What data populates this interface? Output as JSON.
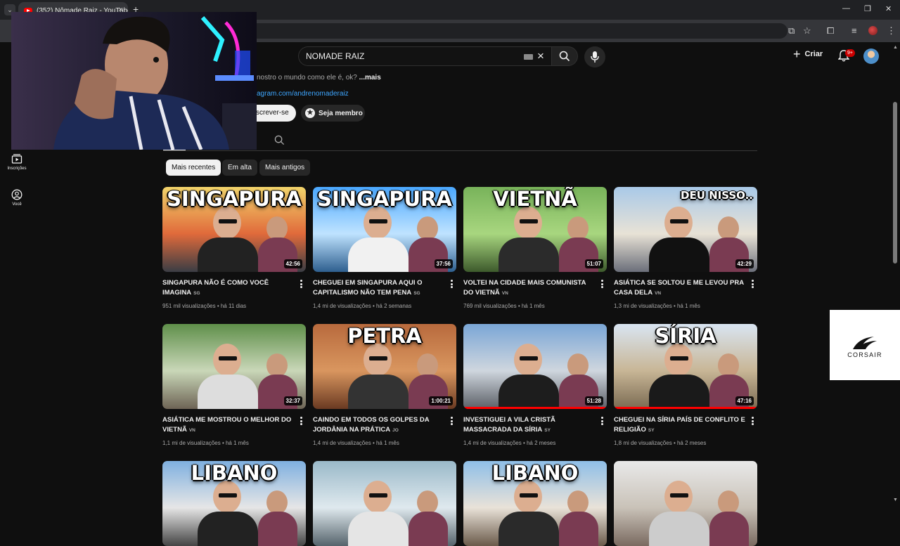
{
  "browser": {
    "tab_title": "(352) Nômade Raiz - YouTube",
    "tab_close": "×",
    "new_tab": "+",
    "window_controls": {
      "minimize": "—",
      "maximize": "❐",
      "close": "✕"
    }
  },
  "header": {
    "search_value": "NOMADE RAIZ",
    "clear_icon": "×",
    "create_label": "Criar",
    "create_icon": "+",
    "notification_badge": "9+"
  },
  "channel": {
    "description": "nostro o mundo como ele é, ok? ",
    "description_more": "...mais",
    "link": "agram.com/andrenomaderaiz",
    "subscribe_label": "screver-se",
    "member_label": "Seja membro",
    "member_icon": "★"
  },
  "sidebar": {
    "items": [
      {
        "label": "Inscrições",
        "icon": "subscriptions-icon"
      },
      {
        "label": "Você",
        "icon": "you-icon"
      }
    ]
  },
  "chips": [
    "Mais recentes",
    "Em alta",
    "Mais antigos"
  ],
  "videos": [
    {
      "thumb_text": "SINGAPURA",
      "duration": "42:56",
      "title": "SINGAPURA NÃO É COMO VOCÊ IMAGINA",
      "cc": "SG",
      "views": "951 mil visualizações",
      "age": "há 11 dias",
      "progress": 0
    },
    {
      "thumb_text": "SINGAPURA",
      "duration": "37:56",
      "title": "CHEGUEI EM SINGAPURA AQUI O CAPITALISMO NÃO TEM PENA",
      "cc": "SG",
      "views": "1,4 mi de visualizações",
      "age": "há 2 semanas",
      "progress": 0
    },
    {
      "thumb_text": "VIETNÃ",
      "duration": "51:07",
      "title": "VOLTEI NA CIDADE MAIS COMUNISTA DO VIETNÃ",
      "cc": "VN",
      "views": "769 mil visualizações",
      "age": "há 1 mês",
      "progress": 0
    },
    {
      "thumb_text": "DEU NISSO..",
      "duration": "42:29",
      "title": "ASIÁTICA SE SOLTOU E ME LEVOU PRA CASA DELA",
      "cc": "VN",
      "views": "1,3 mi de visualizações",
      "age": "há 1 mês",
      "progress": 0
    },
    {
      "thumb_text": "",
      "duration": "32:37",
      "title": "ASIÁTICA ME MOSTROU O MELHOR DO VIETNÃ",
      "cc": "VN",
      "views": "1,1 mi de visualizações",
      "age": "há 1 mês",
      "progress": 0
    },
    {
      "thumb_text": "PETRA",
      "duration": "1:00:21",
      "title": "CAINDO EM TODOS OS GOLPES DA JORDÂNIA NA PRÁTICA",
      "cc": "JO",
      "views": "1,4 mi de visualizações",
      "age": "há 1 mês",
      "progress": 0
    },
    {
      "thumb_text": "",
      "duration": "51:28",
      "title": "INVESTIGUEI A VILA CRISTÃ MASSACRADA DA SÍRIA",
      "cc": "SY",
      "views": "1,4 mi de visualizações",
      "age": "há 2 meses",
      "progress": 1.0
    },
    {
      "thumb_text": "SÍRIA",
      "duration": "47:16",
      "title": "CHEGUEI NA SÍRIA PAÍS DE CONFLITO E RELIGIÃO",
      "cc": "SY",
      "views": "1,8 mi de visualizações",
      "age": "há 2 meses",
      "progress": 1.0
    },
    {
      "thumb_text": "LIBANO",
      "duration": "",
      "title": "",
      "cc": "",
      "views": "",
      "age": "",
      "progress": 0
    },
    {
      "thumb_text": "",
      "duration": "",
      "title": "",
      "cc": "",
      "views": "",
      "age": "",
      "progress": 0
    },
    {
      "thumb_text": "LIBANO",
      "duration": "",
      "title": "",
      "cc": "",
      "views": "",
      "age": "",
      "progress": 0
    },
    {
      "thumb_text": "",
      "duration": "",
      "title": "",
      "cc": "",
      "views": "",
      "age": "",
      "progress": 0
    }
  ],
  "ad": {
    "brand": "CORSAIR"
  },
  "colors": {
    "background": "#0f0f0f",
    "accent": "#ff0000",
    "link": "#3ea6ff"
  }
}
